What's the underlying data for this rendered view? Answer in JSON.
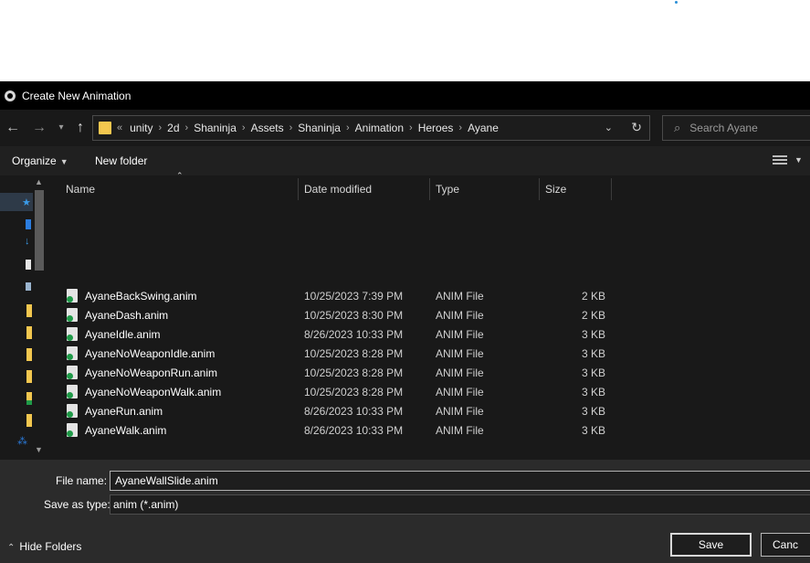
{
  "window": {
    "title": "Create New Animation"
  },
  "nav": {
    "back_icon": "arrow-left-icon",
    "forward_icon": "arrow-right-icon",
    "recent_icon": "chevron-down-icon",
    "up_icon": "arrow-up-icon"
  },
  "address": {
    "overflow": "«",
    "crumbs": [
      "unity",
      "2d",
      "Shaninja",
      "Assets",
      "Shaninja",
      "Animation",
      "Heroes",
      "Ayane"
    ]
  },
  "search": {
    "placeholder": "Search Ayane"
  },
  "toolbar": {
    "organize_label": "Organize",
    "new_folder_label": "New folder"
  },
  "columns": {
    "name": "Name",
    "date": "Date modified",
    "type": "Type",
    "size": "Size"
  },
  "files": [
    {
      "name": "AyaneBackSwing.anim",
      "date": "10/25/2023 7:39 PM",
      "type": "ANIM File",
      "size": "2 KB"
    },
    {
      "name": "AyaneDash.anim",
      "date": "10/25/2023 8:30 PM",
      "type": "ANIM File",
      "size": "2 KB"
    },
    {
      "name": "AyaneIdle.anim",
      "date": "8/26/2023 10:33 PM",
      "type": "ANIM File",
      "size": "3 KB"
    },
    {
      "name": "AyaneNoWeaponIdle.anim",
      "date": "10/25/2023 8:28 PM",
      "type": "ANIM File",
      "size": "3 KB"
    },
    {
      "name": "AyaneNoWeaponRun.anim",
      "date": "10/25/2023 8:28 PM",
      "type": "ANIM File",
      "size": "3 KB"
    },
    {
      "name": "AyaneNoWeaponWalk.anim",
      "date": "10/25/2023 8:28 PM",
      "type": "ANIM File",
      "size": "3 KB"
    },
    {
      "name": "AyaneRun.anim",
      "date": "8/26/2023 10:33 PM",
      "type": "ANIM File",
      "size": "3 KB"
    },
    {
      "name": "AyaneWalk.anim",
      "date": "8/26/2023 10:33 PM",
      "type": "ANIM File",
      "size": "3 KB"
    }
  ],
  "form": {
    "filename_label": "File name:",
    "filename_value": "AyaneWallSlide.anim",
    "savetype_label": "Save as type:",
    "savetype_value": "anim (*.anim)"
  },
  "footer": {
    "hide_folders_label": "Hide Folders",
    "save_label": "Save",
    "cancel_label": "Canc"
  },
  "colors": {
    "folder": "#f3c74f",
    "accent_blue": "#2a8fd6",
    "sync_green": "#1f9a48"
  }
}
